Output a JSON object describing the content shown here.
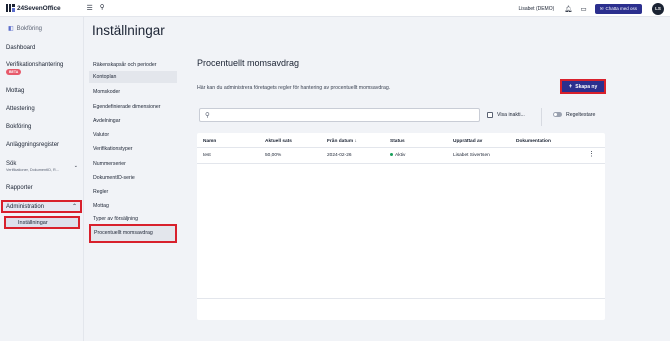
{
  "topbar": {
    "brand": "24SevenOffice",
    "user": "Lisabet (DEMO)",
    "chat_button": "Chatta med oss",
    "avatar_initials": "LS"
  },
  "leftnav": {
    "header": "Bokföring",
    "items": {
      "dashboard": "Dashboard",
      "verifikationshantering": "Verifikationshantering",
      "beta": "BETA",
      "mottag": "Mottag",
      "attestering": "Attestering",
      "bokforing": "Bokföring",
      "anlaggningsregister": "Anläggningsregister",
      "sok": "Sök",
      "sok_sub": "Verifikationer, DokumentID, R...",
      "rapporter": "Rapporter",
      "administration": "Administration",
      "installningar": "Inställningar"
    }
  },
  "page_title": "Inställningar",
  "settings_menu": [
    "Räkenskapsår och perioder",
    "Kontoplan",
    "Momskoder",
    "Egendefinierade dimensioner",
    "Avdelningar",
    "Valutor",
    "Verifikationstyper",
    "Nummerserier",
    "DokumentID-serie",
    "Regler",
    "Mottag",
    "Typer av försäljning",
    "Procentuellt momsavdrag"
  ],
  "content": {
    "title": "Procentuellt momsavdrag",
    "description": "Här kan du administrera företagets regler för hantering av procentuellt momsavdrag.",
    "create_button": "Skapa ny",
    "search_placeholder": "",
    "show_inactive": "Visa inakti...",
    "rule_store": "Regeltestare"
  },
  "table": {
    "headers": {
      "namn": "Namn",
      "aktuell_sats": "Aktuell sats",
      "fran_datum": "Från datum",
      "sort_icon": "↓",
      "status": "Status",
      "upprattad_av": "Upprättad av",
      "dokumentation": "Dokumentation"
    },
    "rows": [
      {
        "namn": "test",
        "aktuell_sats": "50,00%",
        "fran_datum": "2024-02-26",
        "status": "Aktiv",
        "upprattad_av": "Lisabet Sivertsen",
        "dokumentation": ""
      }
    ]
  },
  "colors": {
    "accent": "#2b2f8e",
    "highlight_border": "#d8202c",
    "status_active": "#19a05b",
    "beta_badge": "#e7596a"
  }
}
